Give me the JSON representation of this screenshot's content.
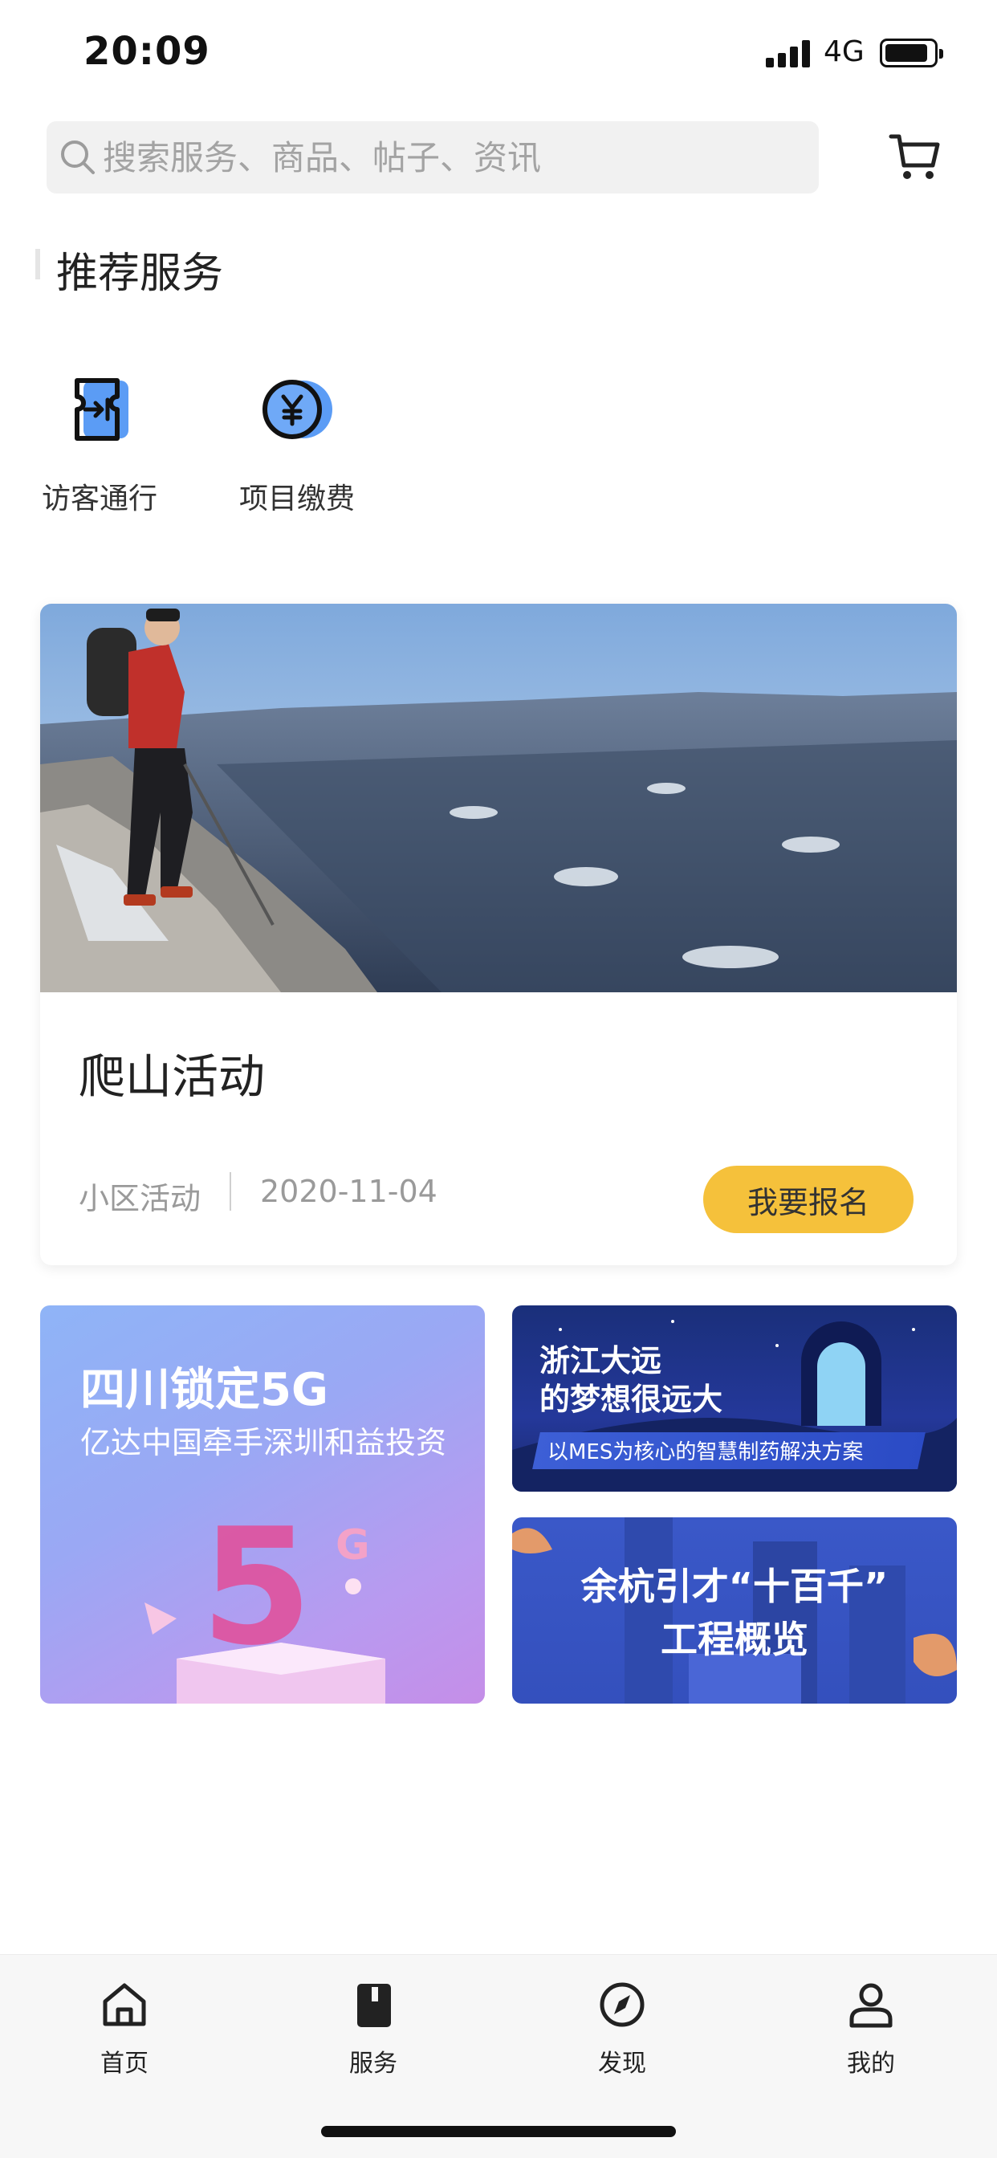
{
  "status_bar": {
    "time": "20:09",
    "network": "4G"
  },
  "search": {
    "placeholder": "搜索服务、商品、帖子、资讯",
    "icon": "search-icon"
  },
  "header": {
    "cart_icon": "cart-icon"
  },
  "section": {
    "title": "推荐服务"
  },
  "services": [
    {
      "label": "访客通行",
      "icon": "visitor-pass-icon"
    },
    {
      "label": "项目缴费",
      "icon": "yuan-payment-icon"
    }
  ],
  "activity_card": {
    "title": "爬山活动",
    "category": "小区活动",
    "date": "2020-11-04",
    "button": "我要报名"
  },
  "banners": {
    "b5g": {
      "title": "四川锁定5G",
      "subtitle": "亿达中国牵手深圳和益投资"
    },
    "zj": {
      "line1": "浙江大远",
      "line2": "的梦想很远大",
      "line3": "以MES为核心的智慧制药解决方案"
    },
    "yh": {
      "line1": "余杭引才“十百千”",
      "line2": "工程概览"
    }
  },
  "tabs": [
    {
      "label": "首页",
      "icon": "home-icon"
    },
    {
      "label": "服务",
      "icon": "service-icon"
    },
    {
      "label": "发现",
      "icon": "compass-icon"
    },
    {
      "label": "我的",
      "icon": "user-icon"
    }
  ],
  "colors": {
    "accent": "#f5c13b",
    "brand_blue": "#3f7ef0"
  }
}
